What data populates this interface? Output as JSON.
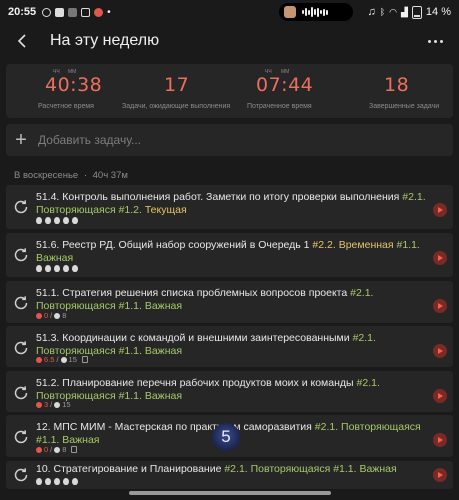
{
  "status_bar": {
    "time": "20:55",
    "battery": "14 %"
  },
  "header": {
    "title": "На эту неделю",
    "back_icon": "arrow-left-icon",
    "more_icon": "more-vertical-icon"
  },
  "stats": [
    {
      "value": "40:38",
      "label": "Расчетное время",
      "units": [
        "ЧЧ",
        "ММ"
      ]
    },
    {
      "value": "17",
      "label": "Задачи, ожидающие выполнения",
      "units": []
    },
    {
      "value": "07:44",
      "label": "Потраченное время",
      "units": [
        "ЧЧ",
        "ММ"
      ]
    },
    {
      "value": "18",
      "label": "Завершенные задачи",
      "units": []
    }
  ],
  "add_task": {
    "placeholder": "Добавить задачу..."
  },
  "section": {
    "day": "В воскресенье",
    "separator": "·",
    "duration": "40ч 37м"
  },
  "tasks": [
    {
      "title": "51.4. Контроль выполнения работ. Заметки по итогу проверки выполнения",
      "tags": [
        {
          "text": "#2.1.",
          "color": "green"
        },
        {
          "text": "Повторяющаяся #1.2.",
          "color": "green"
        },
        {
          "text": "Текущая",
          "color": "yellow"
        }
      ],
      "meta": {
        "eggs": 5
      }
    },
    {
      "title": "51.6. Реестр РД. Общий набор сооружений в Очередь 1",
      "tags": [
        {
          "text": "#2.2.",
          "color": "yellow"
        },
        {
          "text": "Временная",
          "color": "yellow"
        },
        {
          "text": "#1.1.",
          "color": "green"
        },
        {
          "text": "Важная",
          "color": "green"
        }
      ],
      "meta": {
        "eggs": 5
      }
    },
    {
      "title": "51.1. Стратегия решения списка проблемных вопросов проекта",
      "tags": [
        {
          "text": "#2.1.",
          "color": "green"
        },
        {
          "text": "Повторяющаяся #1.1.",
          "color": "green"
        },
        {
          "text": "Важная",
          "color": "green"
        }
      ],
      "meta": {
        "done": "0",
        "total": "8",
        "doc": false
      }
    },
    {
      "title": "51.3. Координации с командой и внешними заинтересованными",
      "tags": [
        {
          "text": "#2.1.",
          "color": "green"
        },
        {
          "text": "Повторяющаяся #1.1.",
          "color": "green"
        },
        {
          "text": "Важная",
          "color": "green"
        }
      ],
      "meta": {
        "done": "6.5",
        "total": "15",
        "doc": true
      }
    },
    {
      "title": "51.2. Планирование перечня рабочих продуктов моих и команды",
      "tags": [
        {
          "text": "#2.1.",
          "color": "green"
        },
        {
          "text": "Повторяющаяся #1.1.",
          "color": "green"
        },
        {
          "text": "Важная",
          "color": "green"
        }
      ],
      "meta": {
        "done": "3",
        "total": "15",
        "doc": false
      }
    },
    {
      "title": "12. МПС МИМ - Мастерская по практикам саморазвития",
      "tags": [
        {
          "text": "#2.1.",
          "color": "green"
        },
        {
          "text": "Повторяющаяся #1.1.",
          "color": "green"
        },
        {
          "text": "Важная",
          "color": "green"
        }
      ],
      "meta": {
        "done": "0",
        "total": "8",
        "doc": true
      }
    },
    {
      "title": "10. Стратегирование и Планирование",
      "tags": [
        {
          "text": "#2.1.",
          "color": "green"
        },
        {
          "text": "Повторяющаяся #1.1.",
          "color": "green"
        },
        {
          "text": "Важная",
          "color": "green"
        }
      ],
      "meta": {
        "eggs": 5
      }
    }
  ],
  "overlay_badge": "5",
  "colors": {
    "accent": "#ee6e5c",
    "tag_green": "#a6c96a",
    "tag_yellow": "#e2c56a",
    "card": "#262626",
    "background": "#1a1a1a"
  }
}
